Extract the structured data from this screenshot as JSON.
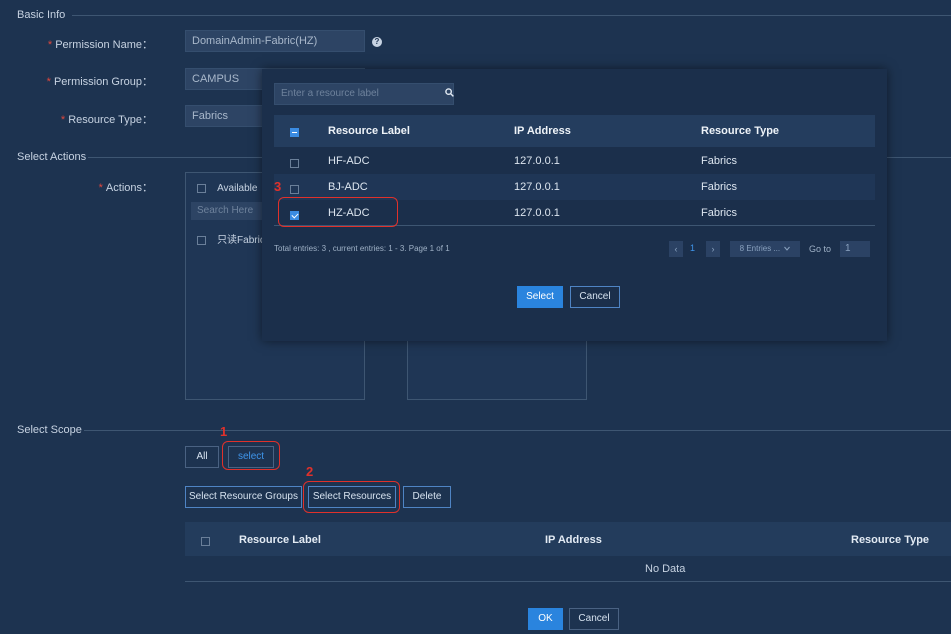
{
  "basic_info": {
    "title": "Basic Info",
    "permission_name_label": "Permission Name：",
    "permission_name_value": "DomainAdmin-Fabric(HZ)",
    "permission_group_label": "Permission Group：",
    "permission_group_value": "CAMPUS",
    "resource_type_label": "Resource Type：",
    "resource_type_value": "Fabrics",
    "required_mark": "*",
    "help_glyph": "?"
  },
  "select_actions": {
    "title": "Select Actions",
    "actions_label": "Actions：",
    "available_header": "Available",
    "search_placeholder": "Search Here",
    "items": [
      "只读Fabrics"
    ]
  },
  "select_scope": {
    "title": "Select Scope",
    "all_button": "All",
    "select_button": "select",
    "select_resource_groups_button": "Select Resource Groups",
    "select_resources_button": "Select Resources",
    "delete_button": "Delete",
    "table_headers": [
      "Resource Label",
      "IP Address",
      "Resource Type"
    ],
    "no_data": "No Data"
  },
  "footer": {
    "ok_button": "OK",
    "cancel_button": "Cancel"
  },
  "modal": {
    "search_placeholder": "Enter a resource label",
    "headers": [
      "Resource Label",
      "IP Address",
      "Resource Type"
    ],
    "rows": [
      {
        "label": "HF-ADC",
        "ip": "127.0.0.1",
        "type": "Fabrics",
        "checked": false
      },
      {
        "label": "BJ-ADC",
        "ip": "127.0.0.1",
        "type": "Fabrics",
        "checked": false
      },
      {
        "label": "HZ-ADC",
        "ip": "127.0.0.1",
        "type": "Fabrics",
        "checked": true
      }
    ],
    "total_text": "Total entries: 3 , current entries: 1 - 3. Page 1 of 1",
    "prev": "‹",
    "page": "1",
    "next": "›",
    "per_page": "8 Entries ...",
    "goto_label": "Go to",
    "goto_value": "1",
    "select_button": "Select",
    "cancel_button": "Cancel"
  },
  "annotations": [
    "1",
    "2",
    "3"
  ],
  "colors": {
    "background": "#1d3350",
    "accent": "#2a84de",
    "annotation": "#e0312b",
    "required": "#e0473d"
  }
}
